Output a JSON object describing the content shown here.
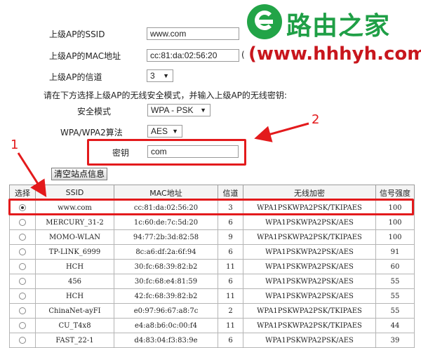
{
  "logo": {
    "text": "路由之家",
    "url": "(www.hhhyh.com)",
    "color": "#1f9f46",
    "url_color": "#c8161d",
    "icon": "router-logo-icon"
  },
  "form": {
    "ssid_label": "上级AP的SSID",
    "ssid_value": "www.com",
    "mac_label": "上级AP的MAC地址",
    "mac_value": "cc:81:da:02:56:20",
    "mac_suffix": "(",
    "channel_label": "上级AP的信道",
    "channel_value": "3",
    "instruction": "请在下方选择上级AP的无线安全模式，并输入上级AP的无线密钥:",
    "security_label": "安全模式",
    "security_value": "WPA - PSK",
    "algo_label": "WPA/WPA2算法",
    "algo_value": "AES",
    "key_label": "密钥",
    "key_value": "com",
    "clear_button": "清空站点信息"
  },
  "annotations": {
    "num1": "1",
    "num2": "2",
    "color": "#e31a1c"
  },
  "table": {
    "headers": [
      "选择",
      "SSID",
      "MAC地址",
      "信道",
      "无线加密",
      "信号强度"
    ],
    "rows": [
      {
        "selected": true,
        "ssid": "www.com",
        "mac": "cc:81:da:02:56:20",
        "channel": "3",
        "enc": "WPA1PSKWPA2PSK/TKIPAES",
        "signal": "100"
      },
      {
        "selected": false,
        "ssid": "MERCURY_31-2",
        "mac": "1c:60:de:7c:5d:20",
        "channel": "6",
        "enc": "WPA1PSKWPA2PSK/AES",
        "signal": "100"
      },
      {
        "selected": false,
        "ssid": "MOMO-WLAN",
        "mac": "94:77:2b:3d:82:58",
        "channel": "9",
        "enc": "WPA1PSKWPA2PSK/TKIPAES",
        "signal": "100"
      },
      {
        "selected": false,
        "ssid": "TP-LINK_6999",
        "mac": "8c:a6:df:2a:6f:94",
        "channel": "6",
        "enc": "WPA1PSKWPA2PSK/AES",
        "signal": "91"
      },
      {
        "selected": false,
        "ssid": "HCH",
        "mac": "30:fc:68:39:82:b2",
        "channel": "11",
        "enc": "WPA1PSKWPA2PSK/AES",
        "signal": "60"
      },
      {
        "selected": false,
        "ssid": "456",
        "mac": "30:fc:68:e4:81:59",
        "channel": "6",
        "enc": "WPA1PSKWPA2PSK/AES",
        "signal": "55"
      },
      {
        "selected": false,
        "ssid": "HCH",
        "mac": "42:fc:68:39:82:b2",
        "channel": "11",
        "enc": "WPA1PSKWPA2PSK/AES",
        "signal": "55"
      },
      {
        "selected": false,
        "ssid": "ChinaNet-ayFI",
        "mac": "e0:97:96:67:a8:7c",
        "channel": "2",
        "enc": "WPA1PSKWPA2PSK/TKIPAES",
        "signal": "55"
      },
      {
        "selected": false,
        "ssid": "CU_T4x8",
        "mac": "e4:a8:b6:0c:00:f4",
        "channel": "11",
        "enc": "WPA1PSKWPA2PSK/TKIPAES",
        "signal": "44"
      },
      {
        "selected": false,
        "ssid": "FAST_22-1",
        "mac": "d4:83:04:f3:83:9e",
        "channel": "6",
        "enc": "WPA1PSKWPA2PSK/AES",
        "signal": "39"
      }
    ]
  }
}
